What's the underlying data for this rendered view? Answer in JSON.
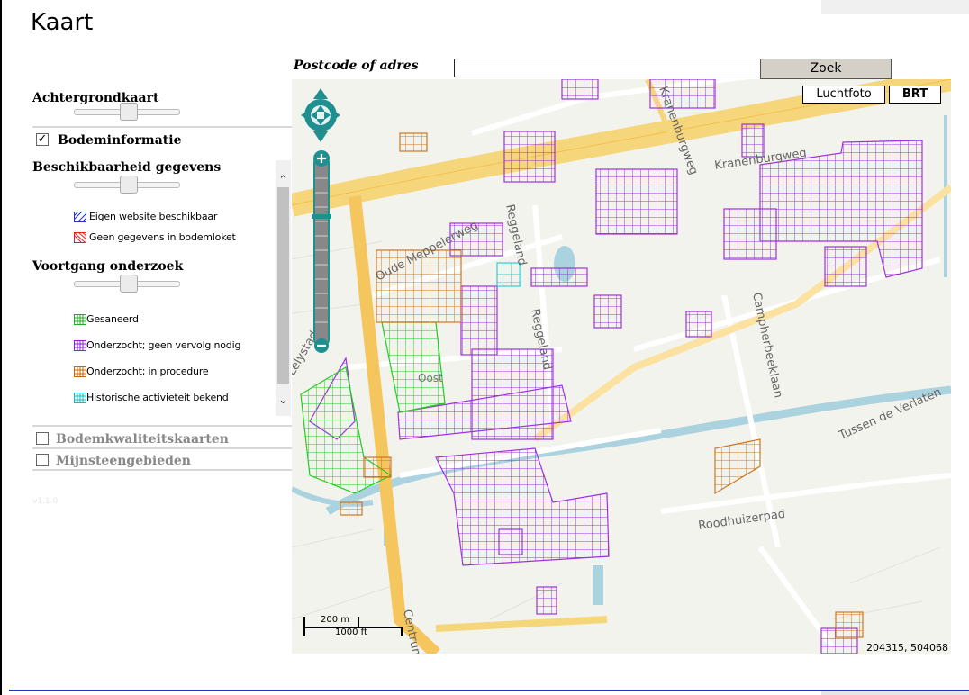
{
  "page": {
    "title": "Kaart"
  },
  "search": {
    "label": "Postcode of adres",
    "value": "",
    "placeholder": "",
    "button": "Zoek"
  },
  "panel": {
    "background_map": {
      "label": "Achtergrondkaart"
    },
    "bodeminformatie": {
      "label": "Bodeminformatie",
      "checked": true
    },
    "availability": {
      "label": "Beschikbaarheid gegevens",
      "legend": [
        {
          "label": "Eigen website beschikbaar",
          "color": "#2233cc"
        },
        {
          "label": "Geen gegevens in bodemloket",
          "color": "#dd2222"
        }
      ]
    },
    "progress": {
      "label": "Voortgang onderzoek",
      "legend": [
        {
          "label": "Gesaneerd",
          "color": "#22aa22"
        },
        {
          "label": "Onderzocht; geen vervolg nodig",
          "color": "#8822cc"
        },
        {
          "label": "Onderzocht; in procedure",
          "color": "#cc6600"
        },
        {
          "label": "Historische activieteit bekend",
          "color": "#11bbbb"
        }
      ]
    },
    "bodemkwaliteit": {
      "label": "Bodemkwaliteitskaarten",
      "checked": false
    },
    "mijnsteen": {
      "label": "Mijnsteengebieden",
      "checked": false
    },
    "version": "v1.1.0"
  },
  "map": {
    "layers": {
      "aerial": "Luchtfoto",
      "topo": "BRT"
    },
    "coordinates": "204315, 504068",
    "scale": {
      "metric": "200 m",
      "imperial": "1000 ft"
    },
    "street_labels": [
      "Kranenburgweg",
      "Kranenburgweg",
      "Oude Meppelerweg",
      "Reggeland",
      "Reggeland",
      "Campherbeeklaan",
      "Tussen de Verlaten",
      "Roodhuizerpad",
      "Oost",
      "Centrum",
      "Lelystad"
    ]
  },
  "colors": {
    "accent_line": "#1a38c8",
    "hatch_purple": "#a030e0",
    "hatch_green": "#22cc22",
    "hatch_orange": "#cc7722",
    "hatch_cyan": "#33cccc",
    "road_yellow": "#f6d67a",
    "water": "#aad3df",
    "nav_teal": "#1f8f8f"
  }
}
